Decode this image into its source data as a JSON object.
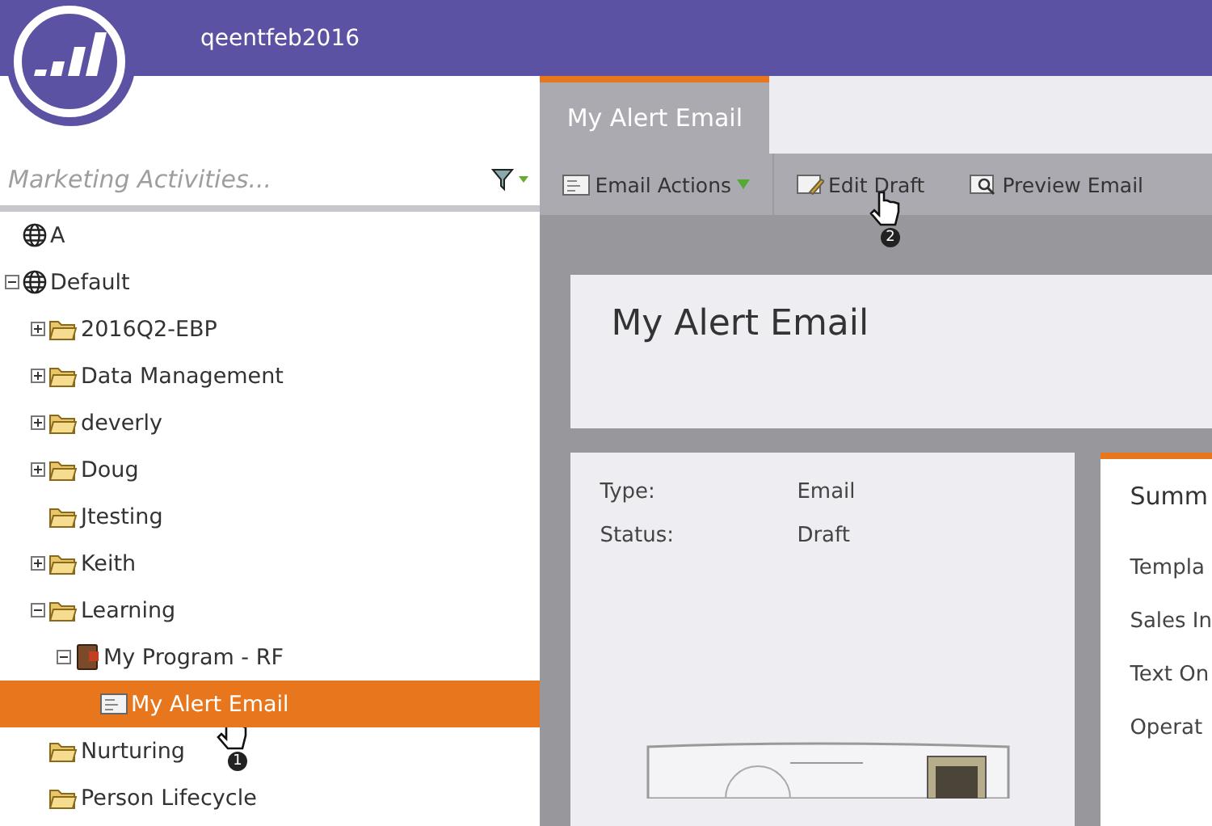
{
  "header": {
    "account": "qeentfeb2016"
  },
  "search": {
    "placeholder": "Marketing Activities..."
  },
  "tree": [
    {
      "label": "A",
      "kind": "workspace",
      "selected": false
    },
    {
      "label": "Default",
      "kind": "workspace",
      "expanded": true,
      "selected": false,
      "children": [
        {
          "label": "2016Q2-EBP",
          "kind": "folder",
          "expanded": false,
          "selected": false
        },
        {
          "label": "Data Management",
          "kind": "folder",
          "expanded": false,
          "selected": false
        },
        {
          "label": "deverly",
          "kind": "folder",
          "expanded": false,
          "selected": false
        },
        {
          "label": "Doug",
          "kind": "folder",
          "expanded": false,
          "selected": false
        },
        {
          "label": "Jtesting",
          "kind": "folder",
          "selected": false
        },
        {
          "label": "Keith",
          "kind": "folder",
          "expanded": false,
          "selected": false
        },
        {
          "label": "Learning",
          "kind": "folder",
          "expanded": true,
          "selected": false,
          "children": [
            {
              "label": "My Program - RF",
              "kind": "program",
              "expanded": true,
              "selected": false,
              "children": [
                {
                  "label": "My Alert Email",
                  "kind": "email",
                  "selected": true
                }
              ]
            }
          ]
        },
        {
          "label": "Nurturing",
          "kind": "folder",
          "selected": false
        },
        {
          "label": "Person Lifecycle",
          "kind": "folder",
          "selected": false
        }
      ]
    }
  ],
  "tabs": [
    {
      "label": "My Alert Email",
      "selected": true
    }
  ],
  "toolbar": [
    {
      "label": "Email Actions",
      "kind": "menu"
    },
    {
      "label": "Edit Draft",
      "kind": "edit"
    },
    {
      "label": "Preview Email",
      "kind": "preview"
    }
  ],
  "title": "My Alert Email",
  "details": [
    {
      "label": "Type:",
      "value": "Email"
    },
    {
      "label": "Status:",
      "value": "Draft"
    }
  ],
  "callouts": [
    {
      "number": "1"
    },
    {
      "number": "2"
    }
  ],
  "summary": {
    "title": "Summ",
    "rows": [
      "Templa",
      "Sales In",
      "Text On",
      "Operat"
    ]
  }
}
